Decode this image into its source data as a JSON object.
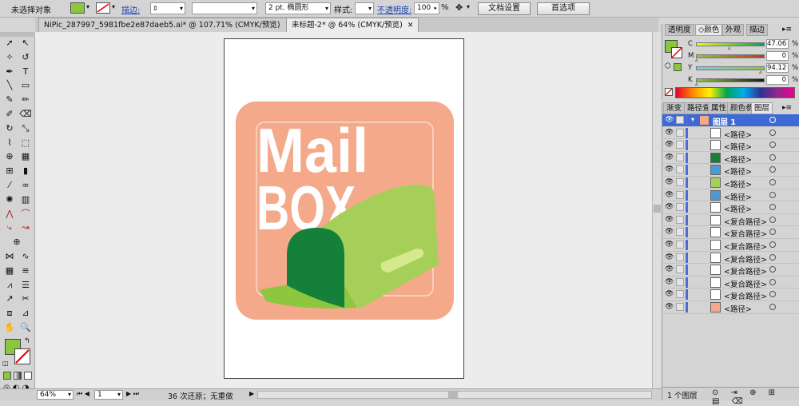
{
  "control_bar": {
    "selection_status": "未选择对象",
    "fill_color": "#8cc63f",
    "stroke_label": "描边:",
    "stroke_value": "",
    "brush_value": "",
    "brush_size": "2 pt. 椭圆形",
    "style_label": "样式:",
    "opacity_label": "不透明度:",
    "opacity_value": "100",
    "opacity_unit": "%",
    "doc_settings_button": "文档设置",
    "preferences_button": "首选项"
  },
  "document_tabs": [
    {
      "label": "NiPic_287997_5981fbe2e87daeb5.ai* @ 107.71% (CMYK/预览)",
      "close": "✕"
    },
    {
      "label": "未标题-2* @ 64% (CMYK/预览)",
      "close": "✕"
    }
  ],
  "artwork": {
    "text_line1": "Mail",
    "text_line2": "BOX",
    "bg_color": "#f4a98a",
    "text_color": "#ffffff",
    "box_light_green": "#a6cf5a",
    "box_dark_green": "#158039",
    "flag_green": "#8dc63f"
  },
  "color_panel": {
    "tabs": [
      "透明度",
      "颜色",
      "外观",
      "描边"
    ],
    "active_tab": "颜色",
    "channels": [
      {
        "key": "C",
        "value": "47.06",
        "unit": "%"
      },
      {
        "key": "M",
        "value": "0",
        "unit": "%"
      },
      {
        "key": "Y",
        "value": "94.12",
        "unit": "%"
      },
      {
        "key": "K",
        "value": "0",
        "unit": "%"
      }
    ]
  },
  "layers_panel": {
    "tabs": [
      "渐变",
      "路径查",
      "属性",
      "颜色参",
      "图层"
    ],
    "active_tab": "图层",
    "layer_name": "图层 1",
    "items": [
      {
        "name": "<路径>",
        "thumb": "#ffffff"
      },
      {
        "name": "<路径>",
        "thumb": "#ffffff"
      },
      {
        "name": "<路径>",
        "thumb": "#158039"
      },
      {
        "name": "<路径>",
        "thumb": "#4a9ad6"
      },
      {
        "name": "<路径>",
        "thumb": "#a6cf5a"
      },
      {
        "name": "<路径>",
        "thumb": "#4a9ad6"
      },
      {
        "name": "<路径>",
        "thumb": "#ffffff"
      },
      {
        "name": "<复合路径>",
        "thumb": "#ffffff"
      },
      {
        "name": "<复合路径>",
        "thumb": "#ffffff"
      },
      {
        "name": "<复合路径>",
        "thumb": "#ffffff"
      },
      {
        "name": "<复合路径>",
        "thumb": "#ffffff"
      },
      {
        "name": "<复合路径>",
        "thumb": "#ffffff"
      },
      {
        "name": "<复合路径>",
        "thumb": "#ffffff"
      },
      {
        "name": "<复合路径>",
        "thumb": "#ffffff"
      },
      {
        "name": "<路径>",
        "thumb": "#f4a98a"
      }
    ],
    "footer_label": "1 个图层"
  },
  "status_bar": {
    "zoom": "64%",
    "page": "1",
    "undo_status": "36 次还原；无重做"
  }
}
